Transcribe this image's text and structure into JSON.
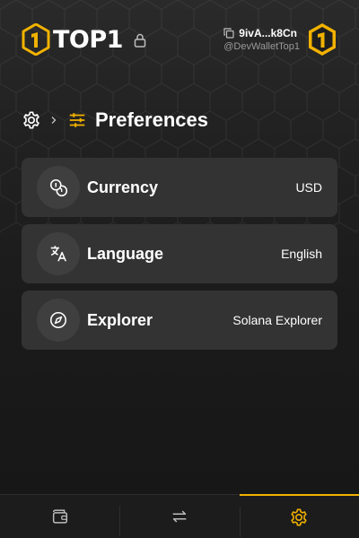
{
  "header": {
    "brand": "TOP1",
    "wallet_address": "9ivA...k8Cn",
    "wallet_handle": "@DevWalletTop1"
  },
  "breadcrumb": {
    "title": "Preferences",
    "icons": [
      "gear-icon",
      "chevron-right-icon",
      "sliders-icon"
    ]
  },
  "preferences": [
    {
      "label": "Currency",
      "value": "USD",
      "icon": "coins-icon"
    },
    {
      "label": "Language",
      "value": "English",
      "icon": "translate-icon"
    },
    {
      "label": "Explorer",
      "value": "Solana Explorer",
      "icon": "compass-icon"
    }
  ],
  "nav": {
    "tabs": [
      {
        "icon": "wallet-icon",
        "active": false
      },
      {
        "icon": "swap-icon",
        "active": false
      },
      {
        "icon": "settings-icon",
        "active": true
      }
    ]
  },
  "colors": {
    "accent": "#f2b200",
    "background": "#1a1a1a",
    "row_background": "#333333",
    "icon_circle": "#3f3f3f",
    "muted_text": "#9a9a9a"
  }
}
